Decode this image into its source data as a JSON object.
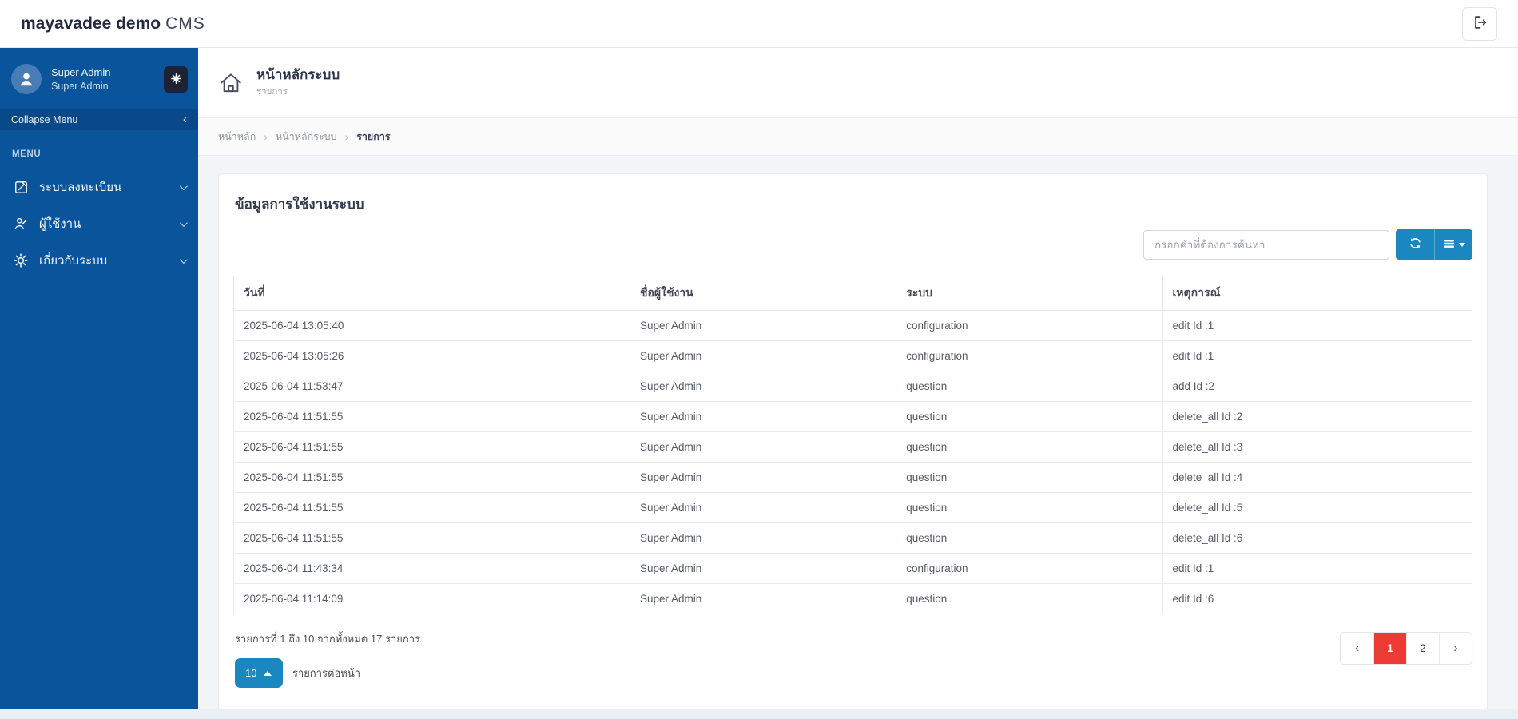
{
  "topbar": {
    "logo_bold": "mayavadee demo",
    "logo_light": "CMS"
  },
  "sidebar": {
    "profile": {
      "name": "Super Admin",
      "role": "Super Admin"
    },
    "collapse_label": "Collapse Menu",
    "collapse_chevron": "‹",
    "menu_header": "MENU",
    "items": [
      {
        "icon": "register-icon",
        "label": "ระบบลงทะเบียน"
      },
      {
        "icon": "users-icon",
        "label": "ผู้ใช้งาน"
      },
      {
        "icon": "about-system-icon",
        "label": "เกี่ยวกับระบบ"
      }
    ]
  },
  "page_header": {
    "title": "หน้าหลักระบบ",
    "subtitle": "รายการ"
  },
  "breadcrumb": {
    "separator": "›",
    "items": [
      "หน้าหลัก",
      "หน้าหลักระบบ",
      "รายการ"
    ]
  },
  "card": {
    "title": "ข้อมูลการใช้งานระบบ",
    "search_placeholder": "กรอกคำที่ต้องการค้นหา"
  },
  "table": {
    "headers": [
      "วันที่",
      "ชื่อผู้ใช้งาน",
      "ระบบ",
      "เหตุการณ์"
    ],
    "rows": [
      [
        "2025-06-04 13:05:40",
        "Super Admin",
        "configuration",
        "edit Id :1"
      ],
      [
        "2025-06-04 13:05:26",
        "Super Admin",
        "configuration",
        "edit Id :1"
      ],
      [
        "2025-06-04 11:53:47",
        "Super Admin",
        "question",
        "add Id :2"
      ],
      [
        "2025-06-04 11:51:55",
        "Super Admin",
        "question",
        "delete_all Id :2"
      ],
      [
        "2025-06-04 11:51:55",
        "Super Admin",
        "question",
        "delete_all Id :3"
      ],
      [
        "2025-06-04 11:51:55",
        "Super Admin",
        "question",
        "delete_all Id :4"
      ],
      [
        "2025-06-04 11:51:55",
        "Super Admin",
        "question",
        "delete_all Id :5"
      ],
      [
        "2025-06-04 11:51:55",
        "Super Admin",
        "question",
        "delete_all Id :6"
      ],
      [
        "2025-06-04 11:43:34",
        "Super Admin",
        "configuration",
        "edit Id :1"
      ],
      [
        "2025-06-04 11:14:09",
        "Super Admin",
        "question",
        "edit Id :6"
      ]
    ]
  },
  "footer": {
    "summary": "รายการที่ 1 ถึง 10 จากทั้งหมด 17 รายการ",
    "page_size_value": "10",
    "per_page_label": "รายการต่อหน้า",
    "pagination": {
      "prev": "‹",
      "page1": "1",
      "page2": "2",
      "next": "›",
      "active_page": "1"
    }
  },
  "colors": {
    "sidebar_blue": "#0a549b",
    "collapse_blue": "#09498a",
    "accent_blue": "#1a87c0",
    "active_red": "#ee3a33"
  }
}
